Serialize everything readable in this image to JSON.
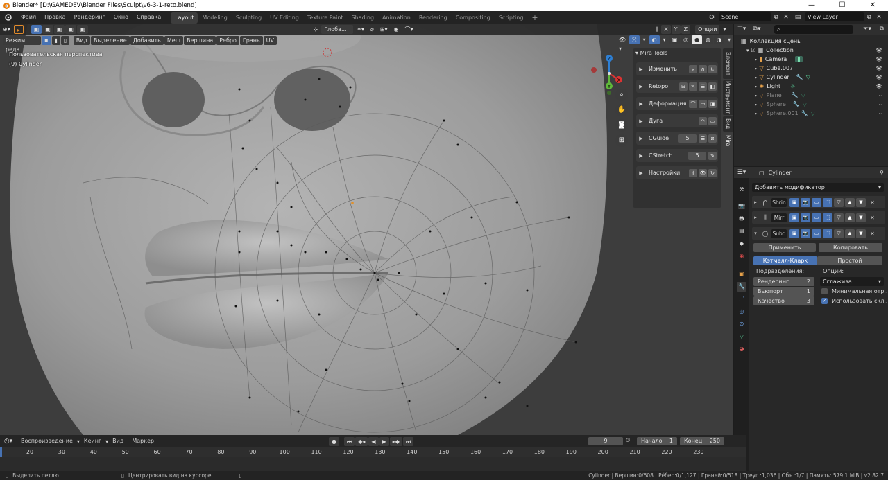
{
  "window": {
    "title": "Blender* [D:\\GAMEDEV\\Blender FIles\\Sculpt\\v6-3-1-reto.blend]",
    "minimize": "—",
    "maximize": "☐",
    "close": "✕"
  },
  "menu": [
    "Файл",
    "Правка",
    "Рендеринг",
    "Окно",
    "Справка"
  ],
  "workspaces": [
    "Layout",
    "Modeling",
    "Sculpting",
    "UV Editing",
    "Texture Paint",
    "Shading",
    "Animation",
    "Rendering",
    "Compositing",
    "Scripting"
  ],
  "workspace_add": "+",
  "scene": "Scene",
  "view_layer": "View Layer",
  "viewport": {
    "mode": "Режим реда...",
    "menu": [
      "Вид",
      "Выделение",
      "Добавить",
      "Меш",
      "Вершина",
      "Ребро",
      "Грань",
      "UV"
    ],
    "orientation": "Глоба...",
    "options": "Опции",
    "axes": [
      "X",
      "Y",
      "Z"
    ],
    "perspective": "Пользовательская перспектива",
    "object_info": "(9) Cylinder"
  },
  "mira": {
    "title": "Mira Tools",
    "rows": [
      {
        "label": "Изменить"
      },
      {
        "label": "Retopo"
      },
      {
        "label": "Деформация"
      },
      {
        "label": "Дуга"
      },
      {
        "label": "CGuide",
        "value": "5"
      },
      {
        "label": "CStretch",
        "value": "5"
      },
      {
        "label": "Настройки"
      }
    ]
  },
  "side_tabs": [
    "Элемент",
    "Инструмент",
    "Вид",
    "Mira"
  ],
  "outliner": {
    "search_placeholder": "",
    "root": "Коллекция сцены",
    "collection": "Collection",
    "items": [
      {
        "name": "Camera",
        "dim": false
      },
      {
        "name": "Cube.007",
        "dim": false
      },
      {
        "name": "Cylinder",
        "dim": false
      },
      {
        "name": "Light",
        "dim": true
      },
      {
        "name": "Plane",
        "dim": true
      },
      {
        "name": "Sphere",
        "dim": true
      },
      {
        "name": "Sphere.001",
        "dim": true
      }
    ]
  },
  "properties": {
    "object": "Cylinder",
    "add_modifier": "Добавить модификатор",
    "modifiers": [
      "Shrin",
      "Mirr",
      "Subd"
    ],
    "apply": "Применить",
    "copy": "Копировать",
    "catmull": "Кэтмелл-Кларк",
    "simple": "Простой",
    "subdivisions_label": "Подразделения:",
    "options_label": "Опции:",
    "render_label": "Рендеринг",
    "render_value": "2",
    "viewport_label": "Вьюпорт",
    "viewport_value": "1",
    "quality_label": "Качество",
    "quality_value": "3",
    "smooth": "Сглажива..",
    "min_opt": "Минимальная отр..",
    "use_opt": "Использовать скл.."
  },
  "timeline": {
    "playback": "Воспроизведение",
    "keying": "Кеинг",
    "view": "Вид",
    "marker": "Маркер",
    "current": "9",
    "start_label": "Начало",
    "start": "1",
    "end_label": "Конец",
    "end": "250",
    "ticks": [
      "20",
      "30",
      "40",
      "50",
      "60",
      "70",
      "80",
      "90",
      "100",
      "110",
      "120",
      "130",
      "140",
      "150",
      "160",
      "170",
      "180",
      "190",
      "200",
      "210",
      "220",
      "230"
    ]
  },
  "status": {
    "left": "Выделить петлю",
    "middle": "Центрировать вид на курсоре",
    "right": "Cylinder | Вершин:0/608 | Рёбер:0/1,127 | Граней:0/518 | Треуг.:1,036 | Объ.:1/7 | Память: 579.1 MiB | v2.82.7"
  },
  "colors": {
    "accent": "#4772b3",
    "background": "#1d1d1d",
    "panel": "#282828"
  }
}
